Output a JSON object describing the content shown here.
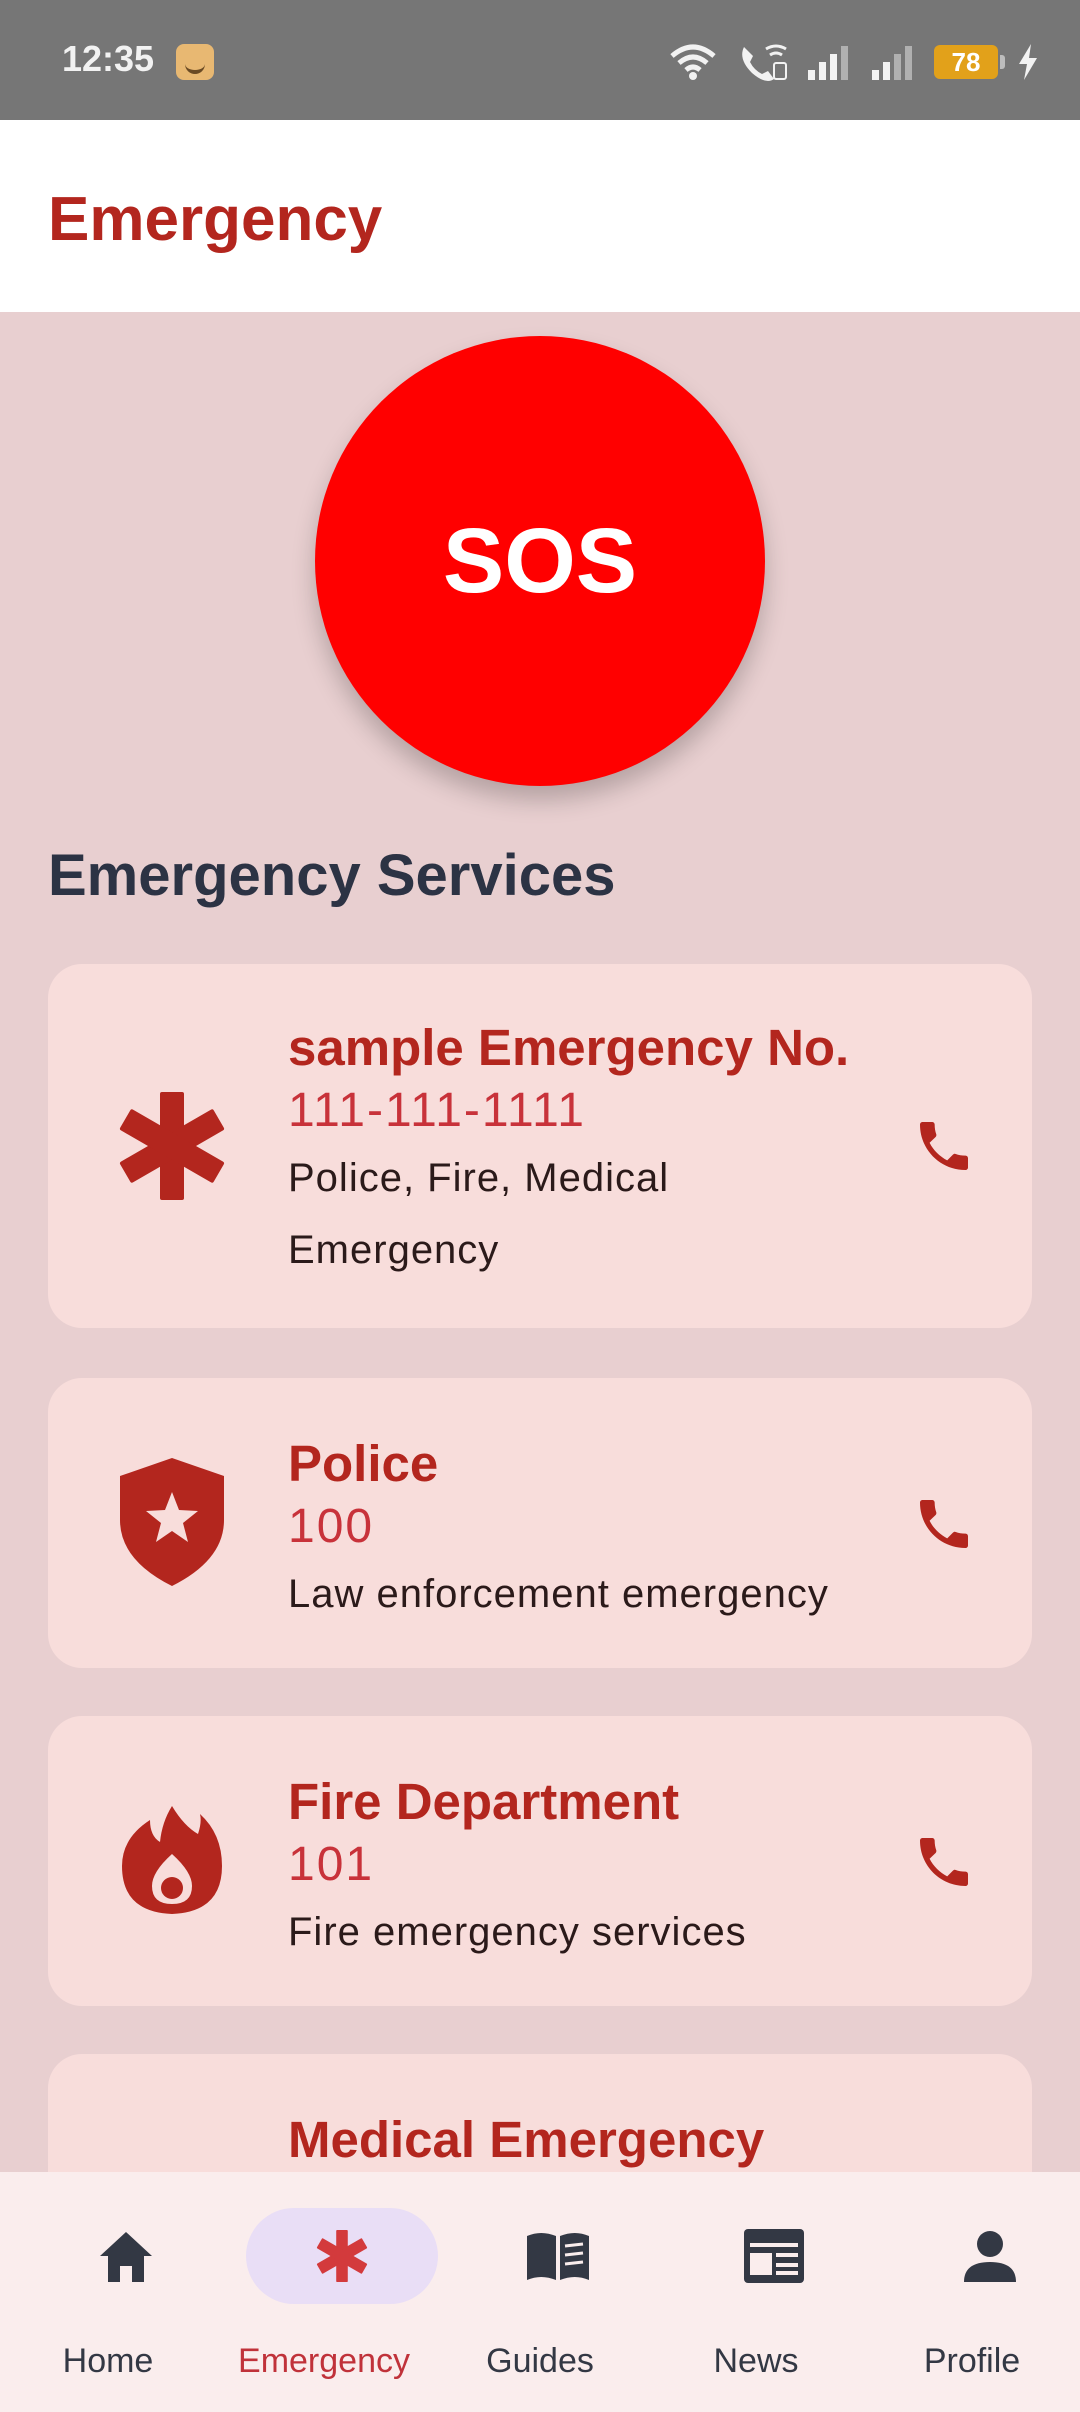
{
  "status_bar": {
    "time": "12:35",
    "battery": "78",
    "icons": [
      "wifi-icon",
      "wifi-calling-icon",
      "signal-icon",
      "signal-icon",
      "battery-icon",
      "charging-icon"
    ]
  },
  "header": {
    "title": "Emergency"
  },
  "sos": {
    "label": "SOS",
    "color": "#ff0000"
  },
  "section_title": "Emergency Services",
  "services": [
    {
      "icon": "asterisk-icon",
      "title": "sample Emergency No.",
      "number": "111-111-1111",
      "description": "Police, Fire, Medical Emergency"
    },
    {
      "icon": "shield-star-icon",
      "title": "Police",
      "number": "100",
      "description": "Law enforcement emergency"
    },
    {
      "icon": "fire-icon",
      "title": "Fire Department",
      "number": "101",
      "description": "Fire emergency services"
    },
    {
      "icon": "medical-icon",
      "title": "Medical Emergency"
    }
  ],
  "nav": {
    "items": [
      {
        "label": "Home",
        "icon": "home-icon"
      },
      {
        "label": "Emergency",
        "icon": "asterisk-icon",
        "active": true
      },
      {
        "label": "Guides",
        "icon": "book-icon"
      },
      {
        "label": "News",
        "icon": "newspaper-icon"
      },
      {
        "label": "Profile",
        "icon": "person-icon"
      }
    ]
  },
  "colors": {
    "accent": "#b3261e",
    "card_bg": "#f8dddb",
    "page_bg": "#e8cfd0",
    "nav_active": "#e9def6"
  }
}
